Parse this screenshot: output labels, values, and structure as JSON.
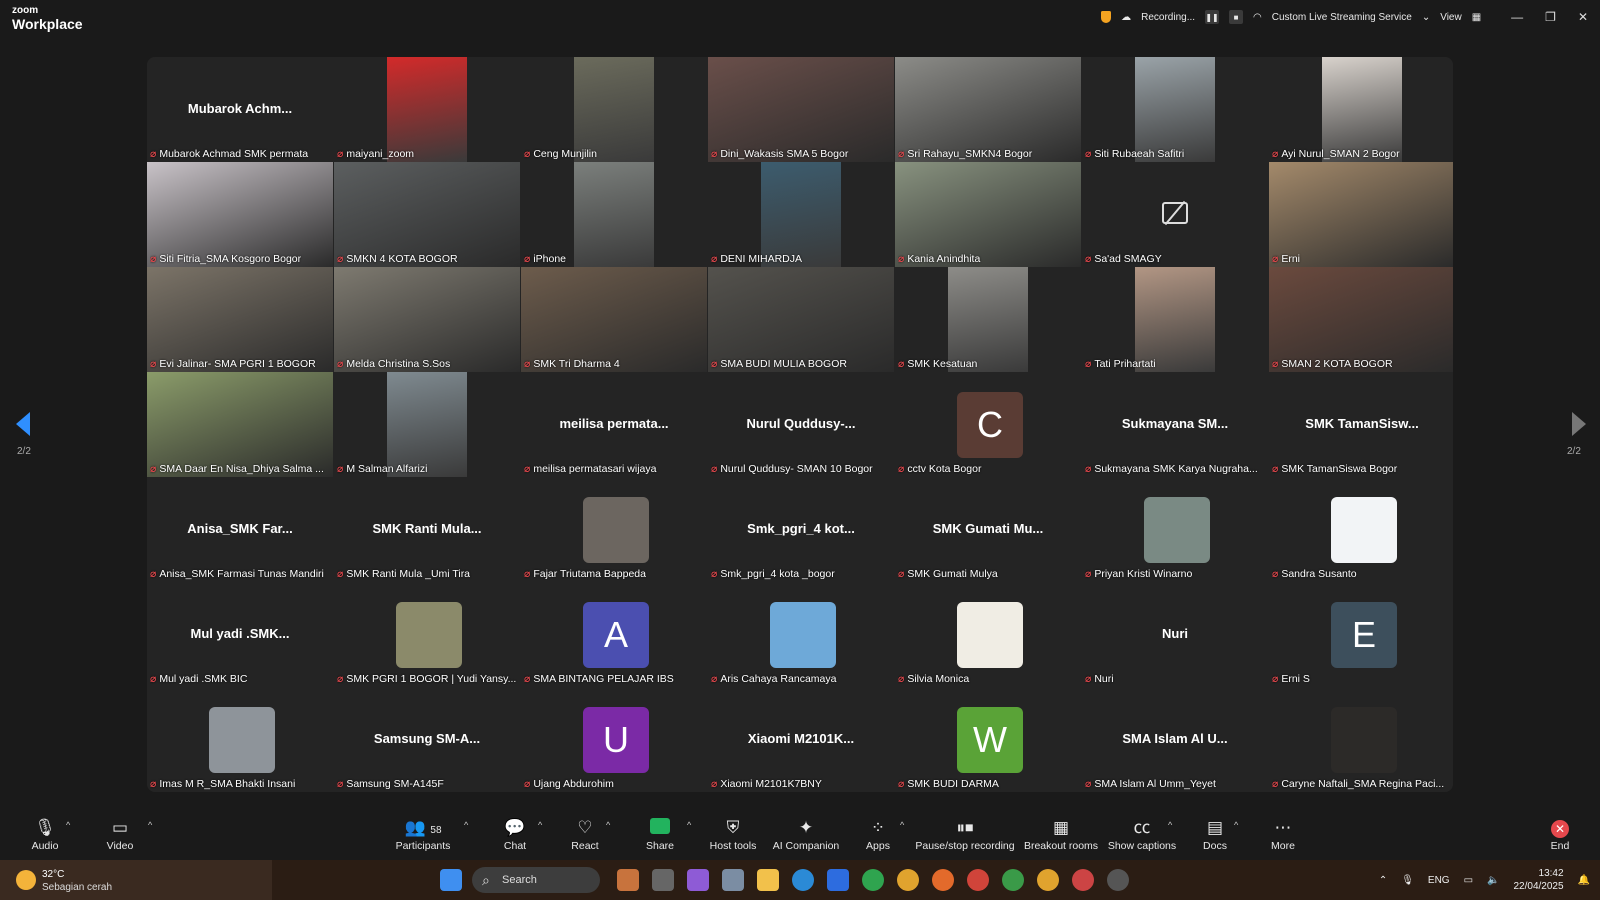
{
  "app": {
    "logo_line1": "zoom",
    "logo_line2": "Workplace"
  },
  "topbar": {
    "recording_label": "Recording...",
    "streaming_label": "Custom Live Streaming Service",
    "view_label": "View",
    "window_controls": [
      "minimize",
      "restore",
      "close"
    ]
  },
  "gallery": {
    "page_left": "2/2",
    "page_right": "2/2",
    "tiles": [
      {
        "label": "Mubarok Achmad SMK permata",
        "big": "Mubarok Achm...",
        "type": "name"
      },
      {
        "label": "maiyani_zoom",
        "type": "photo",
        "color": "#d32a2a"
      },
      {
        "label": "Ceng Munjilin",
        "type": "photo",
        "color": "#6b6b5c"
      },
      {
        "label": "Dini_Wakasis SMA 5 Bogor",
        "type": "video",
        "color": "#6a4f4a"
      },
      {
        "label": "Sri Rahayu_SMKN4 Bogor",
        "type": "video",
        "color": "#8c8c88"
      },
      {
        "label": "Siti Rubaeah Safitri",
        "type": "photo",
        "color": "#9aa3a8"
      },
      {
        "label": "Ayi Nurul_SMAN 2 Bogor",
        "type": "photo",
        "color": "#d8d2cc"
      },
      {
        "label": "Siti Fitria_SMA Kosgoro Bogor",
        "type": "video",
        "color": "#c9c3c8"
      },
      {
        "label": "SMKN 4 KOTA BOGOR",
        "type": "video",
        "color": "#5c5f60"
      },
      {
        "label": "iPhone",
        "type": "photo",
        "color": "#7b7f7c"
      },
      {
        "label": "DENI MIHARDJA",
        "type": "photo",
        "color": "#3c5c6e"
      },
      {
        "label": "Kania Anindhita",
        "type": "video",
        "color": "#88927f"
      },
      {
        "label": "Sa'ad SMAGY",
        "type": "camoff"
      },
      {
        "label": "Erni",
        "type": "video",
        "color": "#a48a6b"
      },
      {
        "label": "Evi Jalinar- SMA PGRI 1 BOGOR",
        "type": "video",
        "color": "#7c7468"
      },
      {
        "label": "Melda Christina S.Sos",
        "type": "video",
        "color": "#7e7a70"
      },
      {
        "label": "SMK Tri Dharma 4",
        "type": "video",
        "color": "#6d5c4c"
      },
      {
        "label": "SMA BUDI MULIA BOGOR",
        "type": "video",
        "color": "#54524d"
      },
      {
        "label": "SMK Kesatuan",
        "type": "photo",
        "color": "#8d8c88"
      },
      {
        "label": "Tati Prihartati",
        "type": "photo",
        "color": "#b29684"
      },
      {
        "label": "SMAN 2 KOTA BOGOR",
        "type": "video",
        "color": "#6b4a3e"
      },
      {
        "label": "SMA Daar En Nisa_Dhiya Salma ...",
        "type": "video",
        "color": "#8b9c6a"
      },
      {
        "label": "M Salman Alfarizi",
        "type": "photo",
        "color": "#7f8a90"
      },
      {
        "label": "meilisa permatasari wijaya",
        "big": "meilisa permata...",
        "type": "name"
      },
      {
        "label": "Nurul Quddusy- SMAN 10 Bogor",
        "big": "Nurul Quddusy-...",
        "type": "name"
      },
      {
        "label": "cctv Kota Bogor",
        "type": "avatar",
        "letter": "C",
        "color": "#5a3c34"
      },
      {
        "label": "Sukmayana SMK Karya Nugraha...",
        "big": "Sukmayana SM...",
        "type": "name"
      },
      {
        "label": "SMK TamanSiswa Bogor",
        "big": "SMK TamanSisw...",
        "type": "name"
      },
      {
        "label": "Anisa_SMK Farmasi Tunas Mandiri",
        "big": "Anisa_SMK Far...",
        "type": "name"
      },
      {
        "label": "SMK Ranti Mula _Umi Tira",
        "big": "SMK Ranti Mula...",
        "type": "name"
      },
      {
        "label": "Fajar Triutama Bappeda",
        "type": "avatar",
        "letter": "",
        "color": "#6c6660"
      },
      {
        "label": "Smk_pgri_4 kota _bogor",
        "big": "Smk_pgri_4 kot...",
        "type": "name"
      },
      {
        "label": "SMK Gumati Mulya",
        "big": "SMK Gumati Mu...",
        "type": "name"
      },
      {
        "label": "Priyan Kristi Winarno",
        "type": "avatar",
        "letter": "",
        "color": "#7a8a84"
      },
      {
        "label": "Sandra Susanto",
        "type": "avatar",
        "letter": "",
        "color": "#f2f4f6"
      },
      {
        "label": "Mul yadi .SMK BIC",
        "big": "Mul yadi .SMK...",
        "type": "name"
      },
      {
        "label": "SMK PGRI 1 BOGOR | Yudi Yansy...",
        "type": "avatar",
        "letter": "",
        "color": "#8b8a6a"
      },
      {
        "label": "SMA BINTANG PELAJAR IBS",
        "type": "avatar",
        "letter": "A",
        "color": "#4b4fb0"
      },
      {
        "label": "Aris Cahaya Rancamaya",
        "type": "avatar",
        "letter": "",
        "color": "#6ea9d8"
      },
      {
        "label": "Silvia Monica",
        "type": "avatar",
        "letter": "",
        "color": "#f0ede4"
      },
      {
        "label": "Nuri",
        "big": "Nuri",
        "type": "name"
      },
      {
        "label": "Erni S",
        "type": "avatar",
        "letter": "E",
        "color": "#3d4f5c"
      },
      {
        "label": "Imas M R_SMA Bhakti Insani",
        "type": "avatar",
        "letter": "",
        "color": "#8e949a"
      },
      {
        "label": "Samsung SM-A145F",
        "big": "Samsung SM-A...",
        "type": "name"
      },
      {
        "label": "Ujang Abdurohim",
        "type": "avatar",
        "letter": "U",
        "color": "#7b2aa6"
      },
      {
        "label": "Xiaomi M2101K7BNY",
        "big": "Xiaomi M2101K...",
        "type": "name"
      },
      {
        "label": "SMK BUDI DARMA",
        "type": "avatar",
        "letter": "W",
        "color": "#5aa337"
      },
      {
        "label": "SMA Islam Al Umm_Yeyet",
        "big": "SMA Islam Al U...",
        "type": "name"
      },
      {
        "label": "Caryne Naftali_SMA Regina Paci...",
        "type": "avatar",
        "letter": "",
        "color": "#2c2a28"
      }
    ]
  },
  "toolbar": {
    "audio": "Audio",
    "video": "Video",
    "participants": "Participants",
    "participants_count": "58",
    "chat": "Chat",
    "react": "React",
    "share": "Share",
    "host_tools": "Host tools",
    "ai_companion": "AI Companion",
    "apps": "Apps",
    "pause_recording": "Pause/stop recording",
    "breakout": "Breakout rooms",
    "captions": "Show captions",
    "docs": "Docs",
    "more": "More",
    "end": "End"
  },
  "taskbar": {
    "temp": "32°C",
    "condition": "Sebagian cerah",
    "search_placeholder": "Search",
    "lang": "ENG",
    "time": "13:42",
    "date": "22/04/2025"
  }
}
